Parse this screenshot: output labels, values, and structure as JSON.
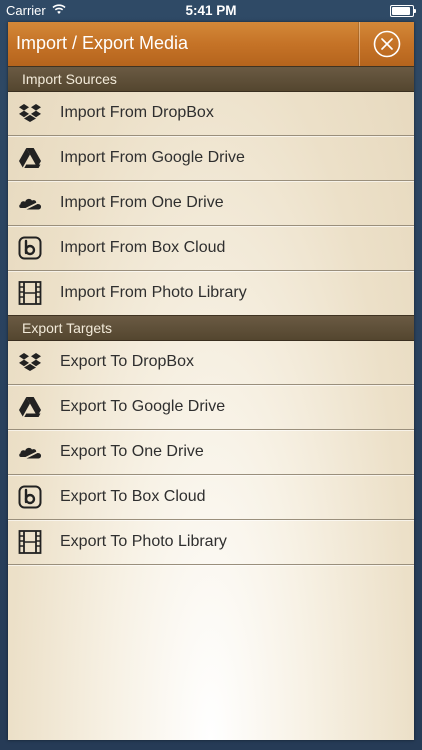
{
  "status": {
    "carrier": "Carrier",
    "time": "5:41 PM"
  },
  "header": {
    "title": "Import / Export Media"
  },
  "import_section": {
    "title": "Import Sources",
    "items": [
      {
        "label": "Import From DropBox",
        "icon": "dropbox-icon"
      },
      {
        "label": "Import From Google Drive",
        "icon": "google-drive-icon"
      },
      {
        "label": "Import From One Drive",
        "icon": "onedrive-icon"
      },
      {
        "label": "Import From Box Cloud",
        "icon": "box-icon"
      },
      {
        "label": "Import From Photo Library",
        "icon": "film-icon"
      }
    ]
  },
  "export_section": {
    "title": "Export Targets",
    "items": [
      {
        "label": "Export To DropBox",
        "icon": "dropbox-icon"
      },
      {
        "label": "Export To Google Drive",
        "icon": "google-drive-icon"
      },
      {
        "label": "Export To One Drive",
        "icon": "onedrive-icon"
      },
      {
        "label": "Export To Box Cloud",
        "icon": "box-icon"
      },
      {
        "label": "Export To Photo Library",
        "icon": "film-icon"
      }
    ]
  }
}
